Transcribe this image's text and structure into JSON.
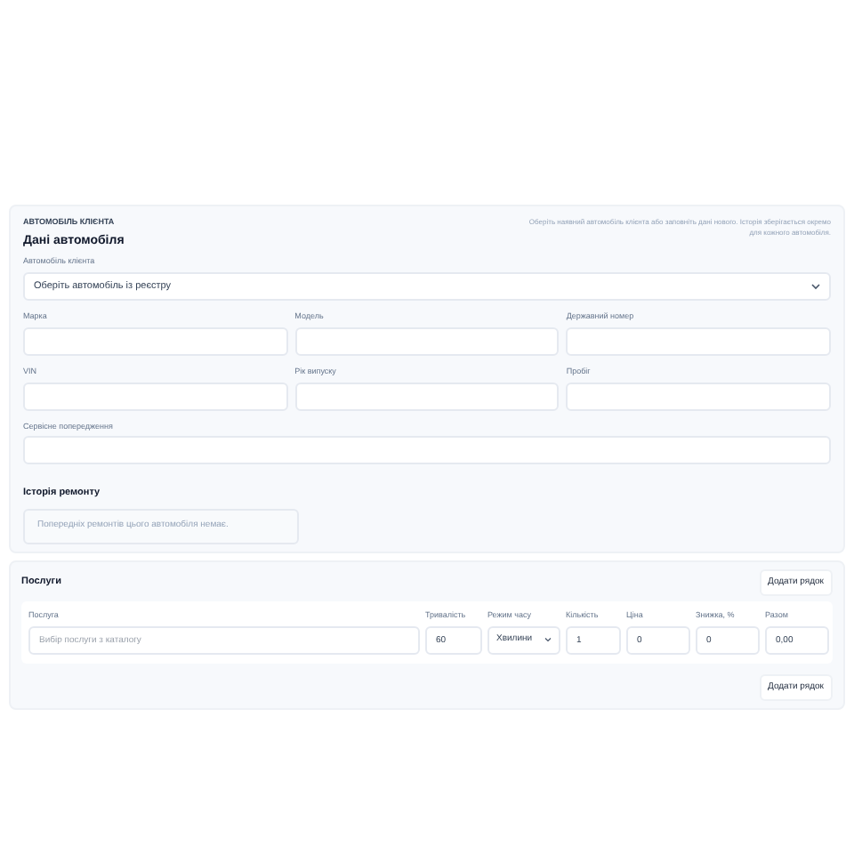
{
  "vehicle": {
    "eyebrow": "АВТОМОБІЛЬ КЛІЄНТА",
    "title": "Дані автомобіля",
    "note": "Оберіть наявний автомобіль клієнта або заповніть дані нового. Історія зберігається окремо для кожного автомобіля.",
    "select": {
      "label": "Автомобіль клієнта",
      "value": "Оберіть автомобіль із реєстру"
    },
    "fields": [
      {
        "label": "Марка"
      },
      {
        "label": "Модель"
      },
      {
        "label": "Державний номер"
      },
      {
        "label": "VIN"
      },
      {
        "label": "Рік випуску"
      },
      {
        "label": "Пробіг"
      }
    ],
    "warning": {
      "label": "Сервісне попередження"
    },
    "history": {
      "title": "Історія ремонту",
      "empty": "Попередніх ремонтів цього автомобіля немає."
    }
  },
  "services": {
    "title": "Послуги",
    "add_top": "Додати рядок",
    "add_bottom": "Додати рядок",
    "columns": [
      "Послуга",
      "Тривалість",
      "Режим часу",
      "Кількість",
      "Ціна",
      "Знижка, %",
      "Разом"
    ],
    "row": {
      "service_placeholder": "Вибір послуги з каталогу",
      "duration": "60",
      "mode": "Хвилини",
      "qty": "1",
      "price": "0",
      "discount": "0",
      "total": "0,00"
    }
  }
}
